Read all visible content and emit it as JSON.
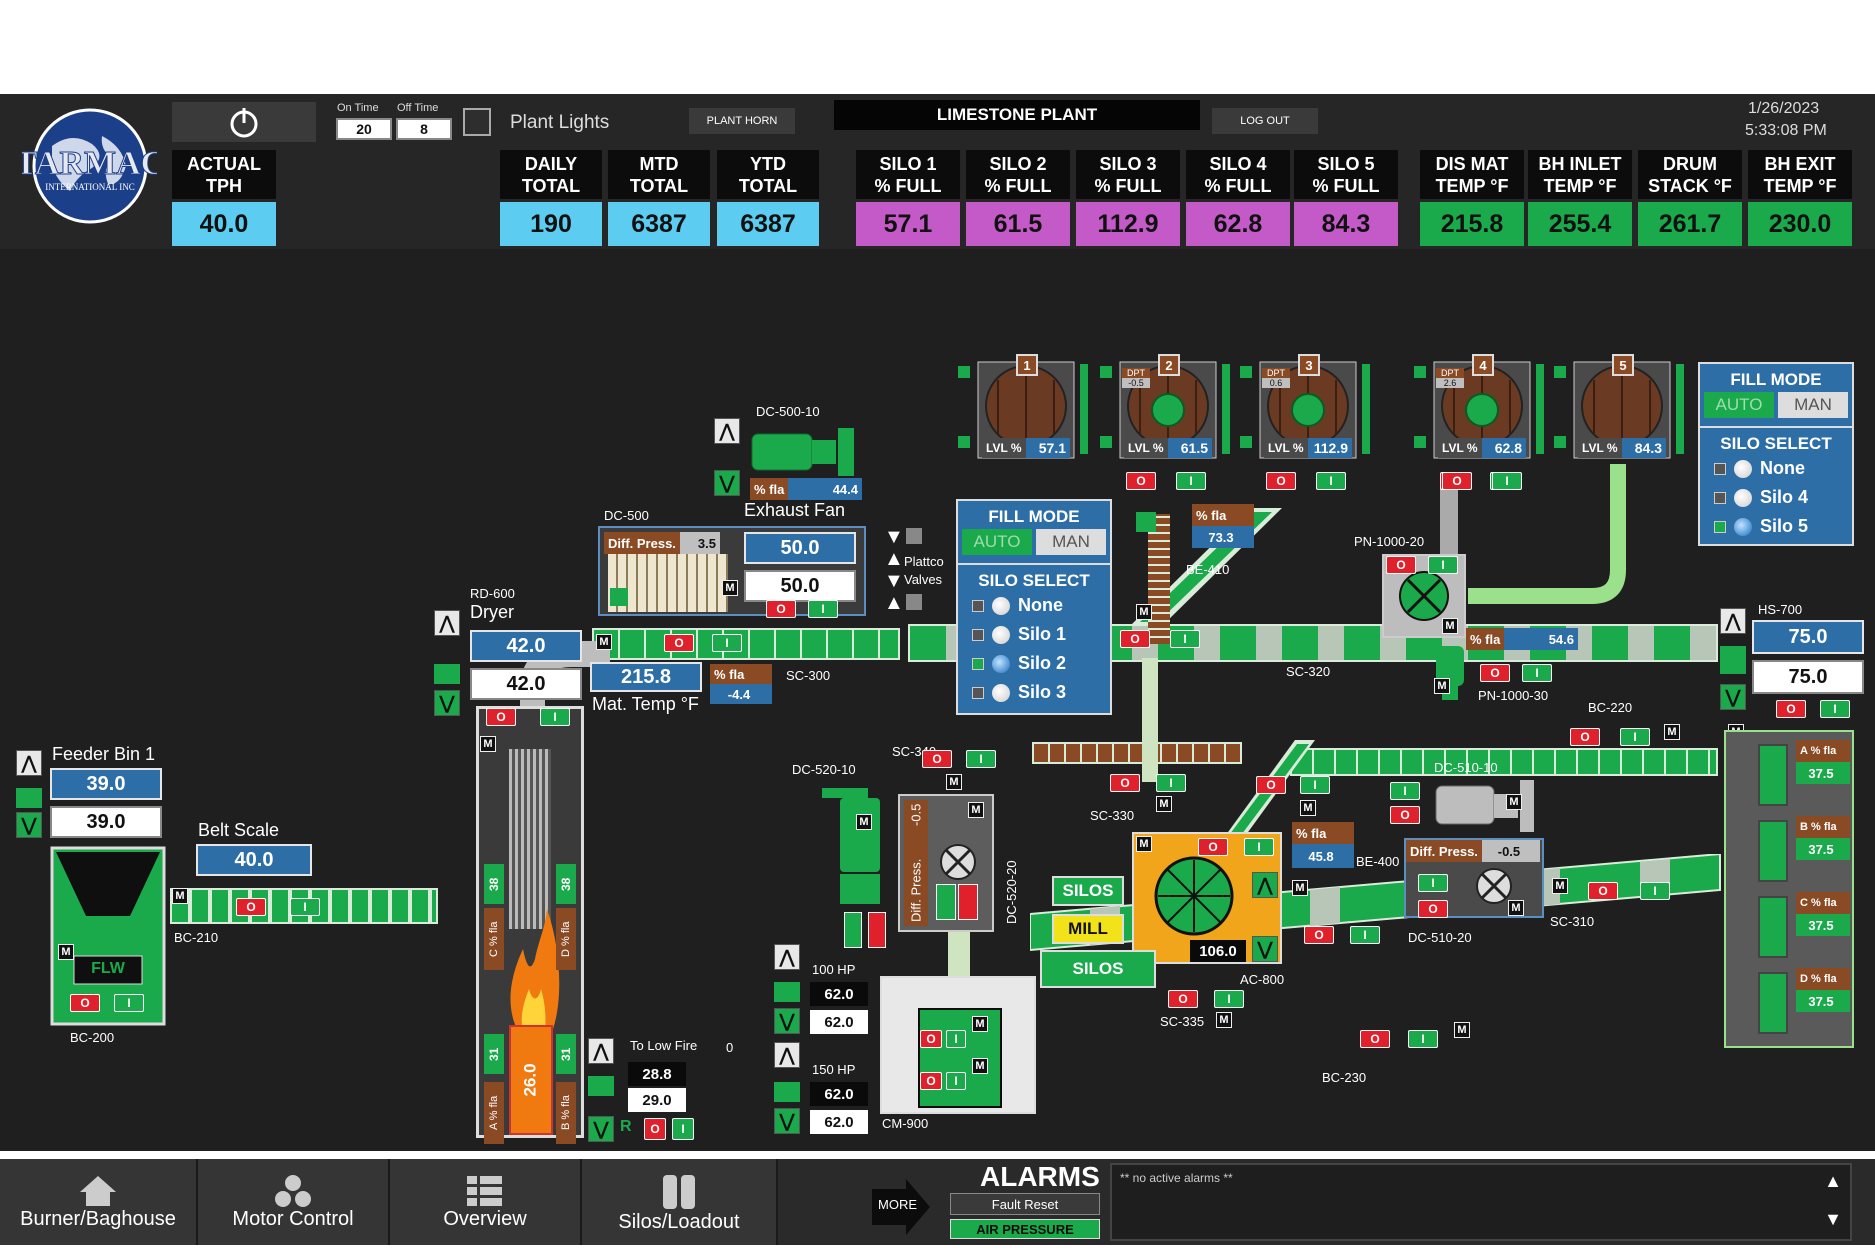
{
  "header": {
    "on_time_label": "On Time",
    "off_time_label": "Off Time",
    "on_time": "20",
    "off_time": "8",
    "plant_lights": "Plant Lights",
    "plant_horn": "PLANT HORN",
    "title": "LIMESTONE PLANT",
    "logout": "LOG OUT",
    "date": "1/26/2023",
    "time": "5:33:08 PM",
    "logo_text": "TARMAC INTERNATIONAL INC",
    "actual_tph": {
      "label1": "ACTUAL",
      "label2": "TPH",
      "value": "40.0"
    },
    "totals": [
      {
        "l1": "DAILY",
        "l2": "TOTAL",
        "v": "190"
      },
      {
        "l1": "MTD",
        "l2": "TOTAL",
        "v": "6387"
      },
      {
        "l1": "YTD",
        "l2": "TOTAL",
        "v": "6387"
      }
    ],
    "silos": [
      {
        "l1": "SILO 1",
        "l2": "% FULL",
        "v": "57.1"
      },
      {
        "l1": "SILO 2",
        "l2": "% FULL",
        "v": "61.5"
      },
      {
        "l1": "SILO 3",
        "l2": "% FULL",
        "v": "112.9"
      },
      {
        "l1": "SILO 4",
        "l2": "% FULL",
        "v": "62.8"
      },
      {
        "l1": "SILO 5",
        "l2": "% FULL",
        "v": "84.3"
      }
    ],
    "temps": [
      {
        "l1": "DIS MAT",
        "l2": "TEMP °F",
        "v": "215.8"
      },
      {
        "l1": "BH INLET",
        "l2": "TEMP °F",
        "v": "255.4"
      },
      {
        "l1": "DRUM",
        "l2": "STACK °F",
        "v": "261.7"
      },
      {
        "l1": "BH EXIT",
        "l2": "TEMP °F",
        "v": "230.0"
      }
    ]
  },
  "colors": {
    "cyan": "#5ccdf0",
    "magenta": "#c45ac8",
    "green": "#1aa94b",
    "blue": "#2d6ea6",
    "red": "#e0202a"
  },
  "silo_tanks": [
    {
      "num": "1",
      "lvl_label": "LVL %",
      "lvl": "57.1"
    },
    {
      "num": "2",
      "lvl_label": "LVL %",
      "lvl": "61.5",
      "dpt": "DPT",
      "dpt_v": "-0.5"
    },
    {
      "num": "3",
      "lvl_label": "LVL %",
      "lvl": "112.9",
      "dpt": "DPT",
      "dpt_v": "0.6"
    },
    {
      "num": "4",
      "lvl_label": "LVL %",
      "lvl": "62.8",
      "dpt": "DPT",
      "dpt_v": "2.6"
    },
    {
      "num": "5",
      "lvl_label": "LVL %",
      "lvl": "84.3"
    }
  ],
  "fill_mode_1": {
    "title": "FILL MODE",
    "auto": "AUTO",
    "man": "MAN",
    "select": "SILO SELECT",
    "options": [
      "None",
      "Silo 1",
      "Silo 2",
      "Silo 3"
    ]
  },
  "fill_mode_2": {
    "title": "FILL MODE",
    "auto": "AUTO",
    "man": "MAN",
    "select": "SILO SELECT",
    "options": [
      "None",
      "Silo 4",
      "Silo 5"
    ]
  },
  "equipment": {
    "dc500_10": "DC-500-10",
    "fla": "% fla",
    "exhaust_fla": "44.4",
    "exhaust_fan": "Exhaust Fan",
    "dc500": "DC-500",
    "diff_press": "Diff. Press.",
    "diff_press_v": "3.5",
    "dc500_sp1": "50.0",
    "dc500_sp2": "50.0",
    "plattco": "Plattco",
    "valves": "Valves",
    "rd600": "RD-600",
    "dryer": "Dryer",
    "dryer_sp1": "42.0",
    "dryer_sp2": "42.0",
    "mat_temp": "215.8",
    "mat_temp_label": "Mat. Temp °F",
    "sc300": "SC-300",
    "sc300_fla": "-4.4",
    "dc520_10": "DC-520-10",
    "sc340": "SC-340",
    "dc520_20": "DC-520-20",
    "dc520_dp": "-0.5",
    "dc520_dp_label": "Diff. Press.",
    "be410": "BE-410",
    "be410_fla": "73.3",
    "pn1000_20": "PN-1000-20",
    "pn1000_30": "PN-1000-30",
    "pn_fla": "54.6",
    "sc320": "SC-320",
    "bc220": "BC-220",
    "hs700": "HS-700",
    "hs700_sp1": "75.0",
    "hs700_sp2": "75.0",
    "sc330": "SC-330",
    "be400": "BE-400",
    "be400_fla": "45.8",
    "dc510_10": "DC-510-10",
    "dc510_20": "DC-510-20",
    "dc510_dp": "-0.5",
    "sc310": "SC-310",
    "silos_btn": "SILOS",
    "mill_btn": "MILL",
    "silos_btn2": "SILOS",
    "ac800": "AC-800",
    "ac800_v": "106.0",
    "sc335": "SC-335",
    "bc230": "BC-230",
    "cm900": "CM-900",
    "hp100": "100 HP",
    "hp100_v1": "62.0",
    "hp100_v2": "62.0",
    "hp150": "150 HP",
    "hp150_v1": "62.0",
    "hp150_v2": "62.0",
    "to_low_fire": "To Low Fire",
    "to_low_fire_v": "0",
    "lf_v1": "28.8",
    "lf_v2": "29.0",
    "feeder_bin": "Feeder Bin 1",
    "feeder_sp1": "39.0",
    "feeder_sp2": "39.0",
    "flw": "FLW",
    "belt_scale": "Belt Scale",
    "belt_scale_v": "40.0",
    "bc210": "BC-210",
    "bc200": "BC-200",
    "flame_v": "26.0",
    "burner_38": "38",
    "burner_31": "31",
    "c_fla": "C % fla",
    "d_fla": "D % fla",
    "a_fla": "A % fla",
    "b_fla": "B % fla",
    "hs_fla": [
      {
        "l": "A % fla",
        "v": "37.5"
      },
      {
        "l": "B % fla",
        "v": "37.5"
      },
      {
        "l": "C % fla",
        "v": "37.5"
      },
      {
        "l": "D % fla",
        "v": "37.5"
      }
    ]
  },
  "footer": {
    "nav": [
      "Burner/Baghouse",
      "Motor Control",
      "Overview",
      "Silos/Loadout"
    ],
    "more": "MORE",
    "alarms": "ALARMS",
    "fault_reset": "Fault Reset",
    "air_pressure": "AIR PRESSURE",
    "alarm_text": "** no active alarms **"
  }
}
